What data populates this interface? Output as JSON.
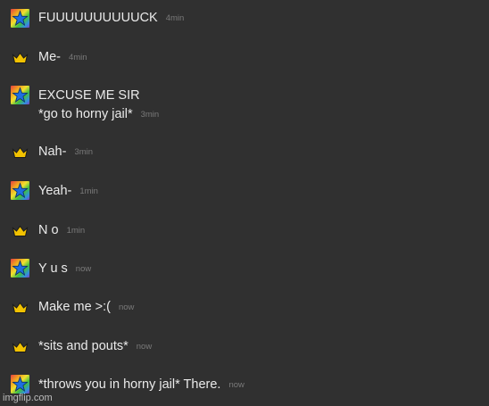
{
  "messages": [
    {
      "text": "FUUUUUUUUUUCK",
      "time": "4min",
      "avatar": "rainbow-star-icon"
    },
    {
      "text": "Me-",
      "time": "4min",
      "avatar": "gold-crown-icon"
    },
    {
      "text": "EXCUSE ME SIR",
      "text2": "*go to horny jail*",
      "time": "3min",
      "avatar": "rainbow-star-icon"
    },
    {
      "text": "Nah-",
      "time": "3min",
      "avatar": "gold-crown-icon"
    },
    {
      "text": "Yeah-",
      "time": "1min",
      "avatar": "rainbow-star-icon"
    },
    {
      "text": "N o",
      "time": "1min",
      "avatar": "gold-crown-icon"
    },
    {
      "text": "Y u s",
      "time": "now",
      "avatar": "rainbow-star-icon"
    },
    {
      "text": "Make me >:(",
      "time": "now",
      "avatar": "gold-crown-icon"
    },
    {
      "text": "*sits and pouts*",
      "time": "now",
      "avatar": "gold-crown-icon"
    },
    {
      "text": "*throws you in horny jail* There.",
      "time": "now",
      "avatar": "rainbow-star-icon"
    }
  ],
  "watermark": "imgflip.com",
  "colors": {
    "background": "#303030",
    "message_text": "#eaeaea",
    "timestamp": "#7a7a7a",
    "crown": "#f2c200",
    "star": "#1e6fe0"
  }
}
